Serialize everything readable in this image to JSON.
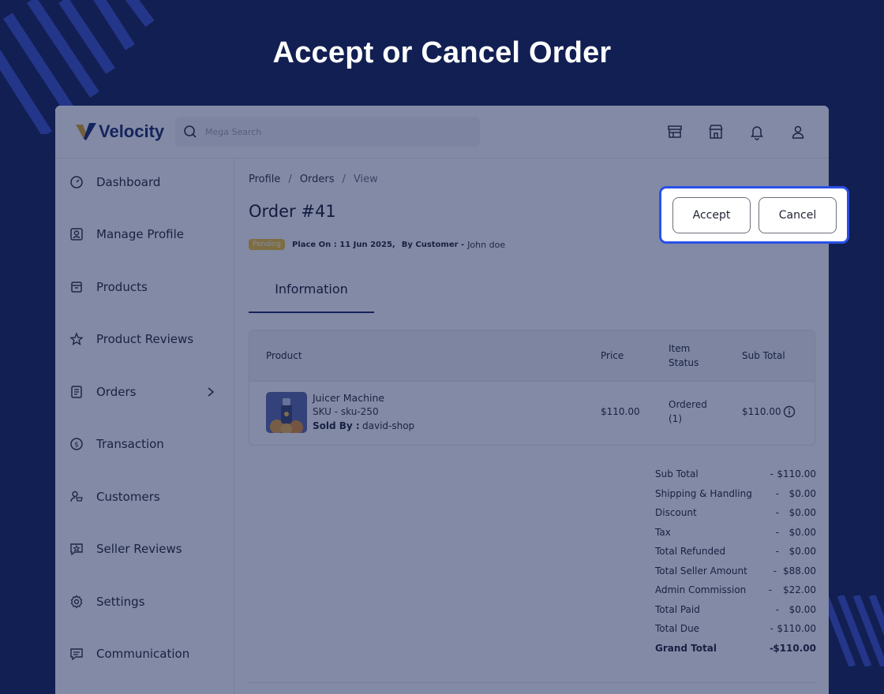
{
  "banner": {
    "title": "Accept or Cancel Order"
  },
  "brand": {
    "name": "Velocity",
    "accent": "#1b2a6a",
    "mark_color": "#d9a524"
  },
  "search": {
    "placeholder": "Mega Search"
  },
  "header_icons": [
    "store-icon",
    "shop-icon",
    "bell-icon",
    "user-icon"
  ],
  "sidebar": {
    "items": [
      {
        "label": "Dashboard",
        "icon": "dashboard-icon"
      },
      {
        "label": "Manage Profile",
        "icon": "profile-icon"
      },
      {
        "label": "Products",
        "icon": "products-icon"
      },
      {
        "label": "Product Reviews",
        "icon": "star-icon"
      },
      {
        "label": "Orders",
        "icon": "orders-icon"
      },
      {
        "label": "Transaction",
        "icon": "dollar-icon"
      },
      {
        "label": "Customers",
        "icon": "customers-icon"
      },
      {
        "label": "Seller Reviews",
        "icon": "review-icon"
      },
      {
        "label": "Settings",
        "icon": "gear-icon"
      },
      {
        "label": "Communication",
        "icon": "chat-icon"
      }
    ]
  },
  "breadcrumb": {
    "items": [
      "Profile",
      "Orders",
      "View"
    ],
    "separator": "/"
  },
  "order": {
    "title": "Order #41",
    "status": "Pending",
    "status_color": "#f2c230",
    "placed_on": "Place On : 11 Jun 2025,",
    "by_customer_label": "By Customer -",
    "customer": "John doe"
  },
  "tabs": {
    "active": "Information"
  },
  "table": {
    "headers": {
      "product": "Product",
      "price": "Price",
      "item_status_1": "Item",
      "item_status_2": "Status",
      "sub_total": "Sub Total"
    },
    "row": {
      "name": "Juicer Machine",
      "sku": "SKU - sku-250",
      "sold_by_label": "Sold By :",
      "sold_by": "david-shop",
      "price": "$110.00",
      "status_1": "Ordered",
      "status_2": "(1)",
      "sub_total": "$110.00"
    }
  },
  "totals": [
    {
      "label": "Sub Total",
      "value": "$110.00"
    },
    {
      "label": "Shipping & Handling",
      "value": "$0.00"
    },
    {
      "label": "Discount",
      "value": "$0.00"
    },
    {
      "label": "Tax",
      "value": "$0.00"
    },
    {
      "label": "Total Refunded",
      "value": "$0.00"
    },
    {
      "label": "Total Seller Amount",
      "value": "$88.00"
    },
    {
      "label": "Admin Commission",
      "value": "$22.00"
    },
    {
      "label": "Total Paid",
      "value": "$0.00"
    },
    {
      "label": "Total Due",
      "value": "$110.00"
    },
    {
      "label": "Grand Total",
      "value": "$110.00"
    }
  ],
  "totals_separator": "-",
  "actions": {
    "accept_label": "Accept",
    "cancel_label": "Cancel",
    "highlight_color": "#2b50e6"
  }
}
